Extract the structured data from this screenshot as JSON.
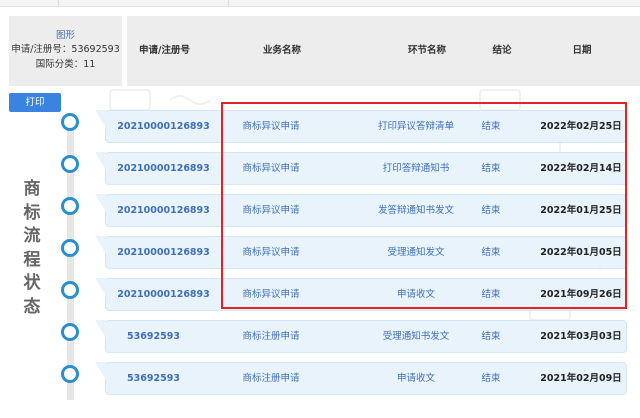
{
  "info": {
    "link": "图形",
    "line1": "申请/注册号：53692593",
    "line2": "国际分类：11"
  },
  "header": {
    "columns": [
      "申请/注册号",
      "业务名称",
      "环节名称",
      "结论",
      "日期"
    ]
  },
  "print_label": "打印",
  "side_title": [
    "商",
    "标",
    "流",
    "程",
    "状",
    "态"
  ],
  "rows": [
    {
      "number": "20210000126893",
      "business": "商标异议申请",
      "step": "打印异议答辩清单",
      "result": "结束",
      "date": "2022年02月25日"
    },
    {
      "number": "20210000126893",
      "business": "商标异议申请",
      "step": "打印答辩通知书",
      "result": "结束",
      "date": "2022年02月14日"
    },
    {
      "number": "20210000126893",
      "business": "商标异议申请",
      "step": "发答辩通知书发文",
      "result": "结束",
      "date": "2022年01月25日"
    },
    {
      "number": "20210000126893",
      "business": "商标异议申请",
      "step": "受理通知发文",
      "result": "结束",
      "date": "2022年01月05日"
    },
    {
      "number": "20210000126893",
      "business": "商标异议申请",
      "step": "申请收文",
      "result": "结束",
      "date": "2021年09月26日"
    },
    {
      "number": "53692593",
      "business": "商标注册申请",
      "step": "受理通知书发文",
      "result": "结束",
      "date": "2021年03月03日"
    },
    {
      "number": "53692593",
      "business": "商标注册申请",
      "step": "申请收文",
      "result": "结束",
      "date": "2021年02月09日"
    }
  ],
  "colors": {
    "accent": "#2a8fca",
    "link": "#3f6fb5",
    "highlight": "#e3222b",
    "button": "#3a83e0"
  }
}
